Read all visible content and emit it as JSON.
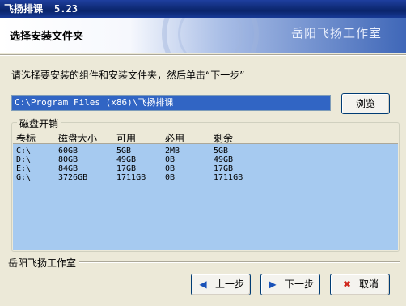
{
  "window": {
    "title": "飞扬排课",
    "version": "5.23"
  },
  "banner": {
    "heading": "选择安装文件夹",
    "brand": "岳阳飞扬工作室"
  },
  "instruction": "请选择要安装的组件和安装文件夹，然后单击“下一步”",
  "path_field": {
    "value": "C:\\Program Files (x86)\\飞扬排课"
  },
  "browse_label": "浏览",
  "disk_group": {
    "label": "磁盘开销",
    "columns": [
      "卷标",
      "磁盘大小",
      "可用",
      "必用",
      "剩余"
    ],
    "rows": [
      [
        "C:\\",
        "60GB",
        "5GB",
        "2MB",
        "5GB"
      ],
      [
        "D:\\",
        "80GB",
        "49GB",
        "0B",
        "49GB"
      ],
      [
        "E:\\",
        "84GB",
        "17GB",
        "0B",
        "17GB"
      ],
      [
        "G:\\",
        "3726GB",
        "1711GB",
        "0B",
        "1711GB"
      ]
    ]
  },
  "footer": {
    "company": "岳阳飞扬工作室",
    "prev_label": "上一步",
    "next_label": "下一步",
    "cancel_label": "取消"
  },
  "icons": {
    "prev": "arrow-left-icon",
    "next": "arrow-right-icon",
    "cancel": "red-x-icon"
  },
  "colors": {
    "titlebar": "#0a246a",
    "selection": "#3165c4",
    "list_background": "#a6caf0"
  }
}
